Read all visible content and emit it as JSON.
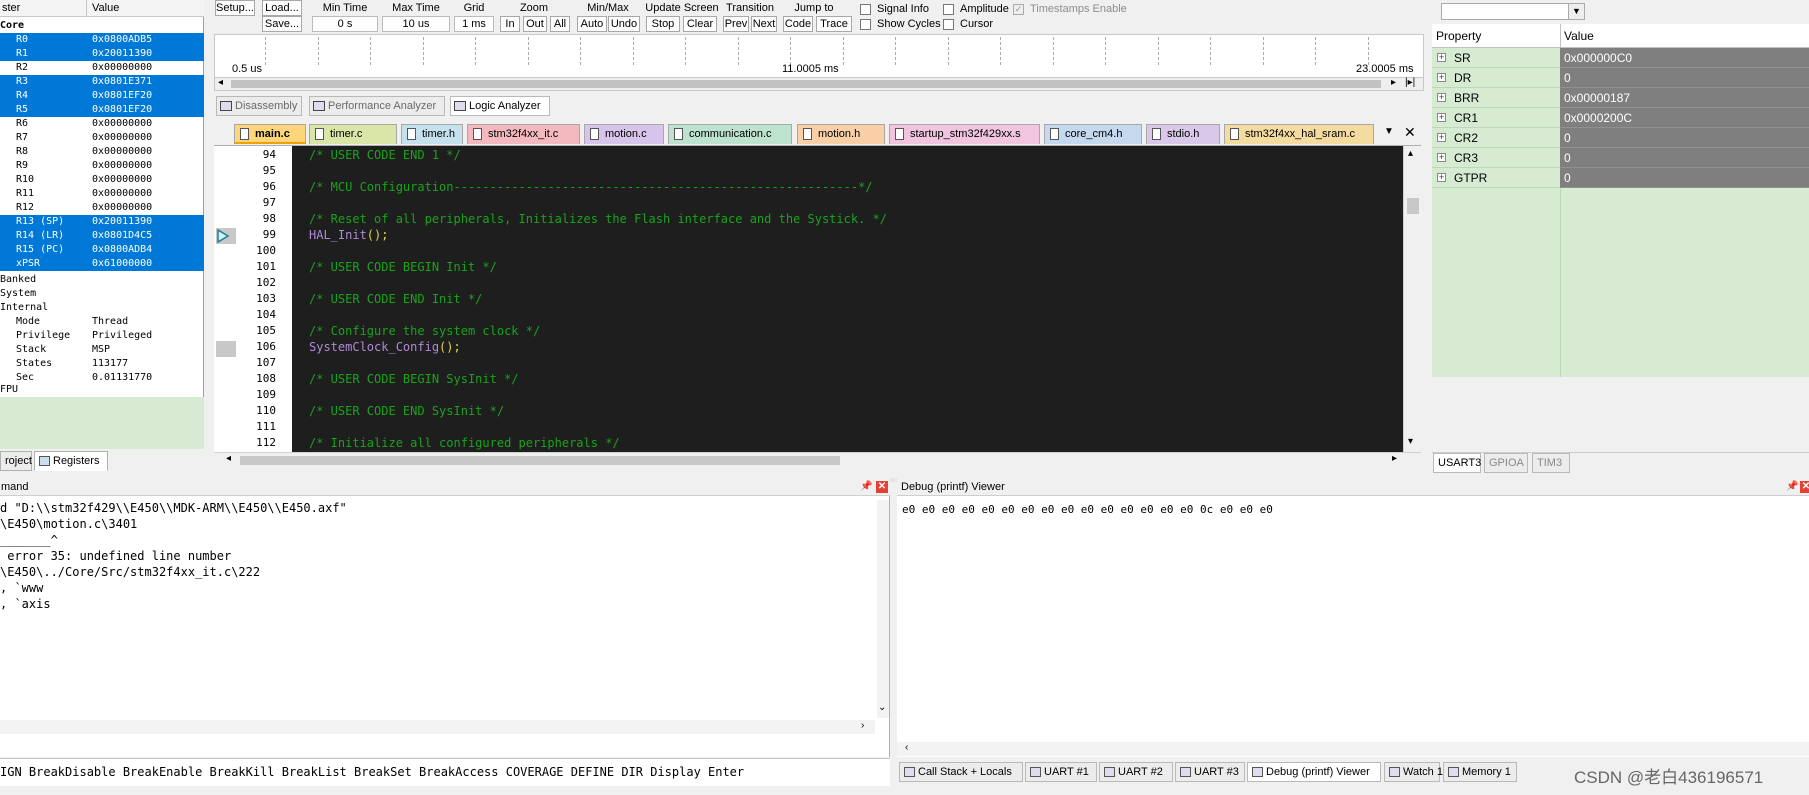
{
  "registers": {
    "col_name": "ster",
    "col_value": "Value",
    "core_label": "Core",
    "rows": [
      {
        "name": "R0",
        "value": "0x0800ADB5"
      },
      {
        "name": "R1",
        "value": "0x20011390"
      },
      {
        "name": "R2",
        "value": "0x00000000"
      },
      {
        "name": "R3",
        "value": "0x0801E371"
      },
      {
        "name": "R4",
        "value": "0x0801EF20"
      },
      {
        "name": "R5",
        "value": "0x0801EF20"
      },
      {
        "name": "R6",
        "value": "0x00000000"
      },
      {
        "name": "R7",
        "value": "0x00000000"
      },
      {
        "name": "R8",
        "value": "0x00000000"
      },
      {
        "name": "R9",
        "value": "0x00000000"
      },
      {
        "name": "R10",
        "value": "0x00000000"
      },
      {
        "name": "R11",
        "value": "0x00000000"
      },
      {
        "name": "R12",
        "value": "0x00000000"
      },
      {
        "name": "R13 (SP)",
        "value": "0x20011390"
      },
      {
        "name": "R14 (LR)",
        "value": "0x0801D4C5"
      },
      {
        "name": "R15 (PC)",
        "value": "0x0800ADB4"
      },
      {
        "name": "xPSR",
        "value": "0x61000000"
      }
    ],
    "groups": {
      "banked": "Banked",
      "system": "System",
      "internal": "Internal",
      "fpu": "FPU"
    },
    "internal": [
      {
        "name": "Mode",
        "value": "Thread"
      },
      {
        "name": "Privilege",
        "value": "Privileged"
      },
      {
        "name": "Stack",
        "value": "MSP"
      },
      {
        "name": "States",
        "value": "113177"
      },
      {
        "name": "Sec",
        "value": "0.01131770"
      }
    ],
    "tabs": {
      "project": "roject",
      "registers": "Registers"
    }
  },
  "logic_analyzer": {
    "setup": "Setup...",
    "load": "Load...",
    "save": "Save...",
    "min_time_label": "Min Time",
    "min_time": "0 s",
    "max_time_label": "Max Time",
    "max_time": "10 us",
    "grid_label": "Grid",
    "grid": "1 ms",
    "zoom_label": "Zoom",
    "zoom_in": "In",
    "zoom_out": "Out",
    "zoom_all": "All",
    "minmax_label": "Min/Max",
    "auto": "Auto",
    "undo": "Undo",
    "update_label": "Update Screen",
    "stop": "Stop",
    "clear": "Clear",
    "transition_label": "Transition",
    "prev": "Prev",
    "next": "Next",
    "jump_label": "Jump to",
    "code": "Code",
    "trace": "Trace",
    "signal_info": "Signal Info",
    "show_cycles": "Show Cycles",
    "amplitude": "Amplitude",
    "cursor": "Cursor",
    "timestamps": "Timestamps Enable",
    "t_start": "0.5 us",
    "t_mid": "11.0005 ms",
    "t_end": "23.0005 ms"
  },
  "view_tabs": [
    "Disassembly",
    "Performance Analyzer",
    "Logic Analyzer"
  ],
  "file_tabs": [
    {
      "label": "main.c",
      "color": "#fdd57a"
    },
    {
      "label": "timer.c",
      "color": "#d9e6a8"
    },
    {
      "label": "timer.h",
      "color": "#c6e1ee"
    },
    {
      "label": "stm32f4xx_it.c",
      "color": "#f4b9be"
    },
    {
      "label": "motion.c",
      "color": "#d8c4ea"
    },
    {
      "label": "communication.c",
      "color": "#bde3cf"
    },
    {
      "label": "motion.h",
      "color": "#f9cfa8"
    },
    {
      "label": "startup_stm32f429xx.s",
      "color": "#f1c5e0"
    },
    {
      "label": "core_cm4.h",
      "color": "#c4d9ee"
    },
    {
      "label": "stdio.h",
      "color": "#d9c8ea"
    },
    {
      "label": "stm32f4xx_hal_sram.c",
      "color": "#f4dba0"
    }
  ],
  "code": {
    "lines": [
      {
        "n": "94",
        "text": "/* USER CODE END 1 */",
        "kind": "comment"
      },
      {
        "n": "95",
        "text": "",
        "kind": "comment"
      },
      {
        "n": "96",
        "text": "/* MCU Configuration--------------------------------------------------------*/",
        "kind": "comment"
      },
      {
        "n": "97",
        "text": "",
        "kind": "comment"
      },
      {
        "n": "98",
        "text": "/* Reset of all peripherals, Initializes the Flash interface and the Systick. */",
        "kind": "comment"
      },
      {
        "n": "99",
        "fn": "HAL_Init",
        "punct": "();",
        "kind": "call"
      },
      {
        "n": "100",
        "text": "",
        "kind": "comment"
      },
      {
        "n": "101",
        "text": "/* USER CODE BEGIN Init */",
        "kind": "comment"
      },
      {
        "n": "102",
        "text": "",
        "kind": "comment"
      },
      {
        "n": "103",
        "text": "/* USER CODE END Init */",
        "kind": "comment"
      },
      {
        "n": "104",
        "text": "",
        "kind": "comment"
      },
      {
        "n": "105",
        "text": "/* Configure the system clock */",
        "kind": "comment"
      },
      {
        "n": "106",
        "fn": "SystemClock_Config",
        "punct": "();",
        "kind": "call"
      },
      {
        "n": "107",
        "text": "",
        "kind": "comment"
      },
      {
        "n": "108",
        "text": "/* USER CODE BEGIN SysInit */",
        "kind": "comment"
      },
      {
        "n": "109",
        "text": "",
        "kind": "comment"
      },
      {
        "n": "110",
        "text": "/* USER CODE END SysInit */",
        "kind": "comment"
      },
      {
        "n": "111",
        "text": "",
        "kind": "comment"
      },
      {
        "n": "112",
        "text": "/* Initialize all configured peripherals */",
        "kind": "comment"
      }
    ]
  },
  "peripheral": {
    "col_property": "Property",
    "col_value": "Value",
    "rows": [
      {
        "name": "SR",
        "value": "0x000000C0"
      },
      {
        "name": "DR",
        "value": "0"
      },
      {
        "name": "BRR",
        "value": "0x00000187"
      },
      {
        "name": "CR1",
        "value": "0x0000200C"
      },
      {
        "name": "CR2",
        "value": "0"
      },
      {
        "name": "CR3",
        "value": "0"
      },
      {
        "name": "GTPR",
        "value": "0"
      }
    ],
    "tabs": [
      "USART3",
      "GPIOA",
      "TIM3"
    ]
  },
  "command": {
    "title": "mand",
    "lines": [
      "d \"D:\\\\stm32f429\\\\E450\\\\MDK-ARM\\\\E450\\\\E450.axf\"",
      "\\E450\\motion.c\\3401",
      "_______^",
      " error 35: undefined line number",
      "\\E450\\../Core/Src/stm32f4xx_it.c\\222",
      ", `www",
      ", `axis"
    ],
    "cmdline": "IGN BreakDisable BreakEnable BreakKill BreakList BreakSet BreakAccess COVERAGE DEFINE DIR Display Enter"
  },
  "printf": {
    "title": "Debug (printf) Viewer",
    "content": "e0 e0 e0 e0 e0 e0 e0 e0 e0 e0 e0 e0 e0 e0 e0 0c e0 e0 e0"
  },
  "bottom_tabs": [
    "Call Stack + Locals",
    "UART #1",
    "UART #2",
    "UART #3",
    "Debug (printf) Viewer",
    "Watch 1",
    "Memory 1"
  ],
  "watermark": "CSDN @老白436196571"
}
